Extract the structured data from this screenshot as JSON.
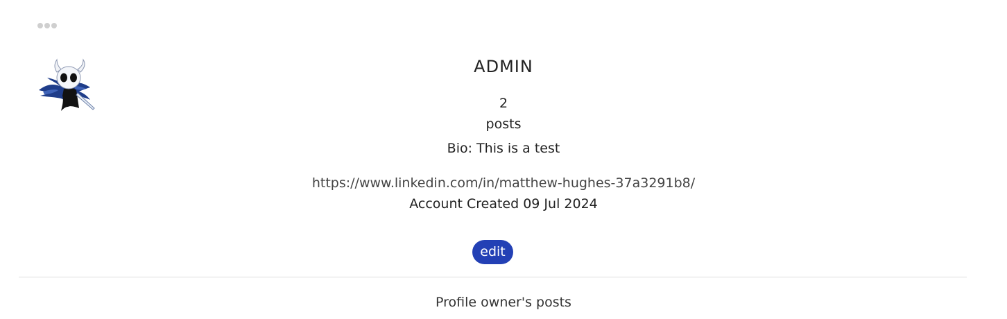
{
  "menu": {
    "icon": "more-options-icon"
  },
  "avatar": {
    "icon": "knight-avatar"
  },
  "profile": {
    "username": "ADMIN",
    "post_count": "2",
    "post_label": "posts",
    "bio": "Bio: This is a test",
    "link": "https://www.linkedin.com/in/matthew-hughes-37a3291b8/",
    "created": "Account Created 09 Jul 2024"
  },
  "actions": {
    "edit_label": "edit"
  },
  "colors": {
    "accent": "#2340b5",
    "menu_dots": "#cfcfcf"
  },
  "posts_section": {
    "title": "Profile owner's posts"
  }
}
